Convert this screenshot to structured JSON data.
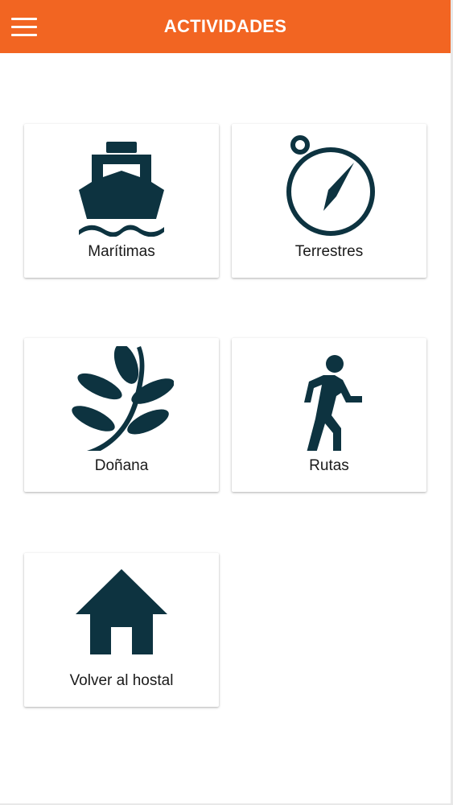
{
  "header": {
    "title": "ACTIVIDADES",
    "background_color": "#f26522",
    "menu_icon": "hamburger-menu-icon"
  },
  "icon_color": "#0d3340",
  "cards": [
    {
      "label": "Marítimas",
      "icon": "ship-icon"
    },
    {
      "label": "Terrestres",
      "icon": "compass-icon"
    },
    {
      "label": "Doñana",
      "icon": "leaf-branch-icon"
    },
    {
      "label": "Rutas",
      "icon": "walking-person-icon"
    },
    {
      "label": "Volver al hostal",
      "icon": "home-icon"
    }
  ]
}
